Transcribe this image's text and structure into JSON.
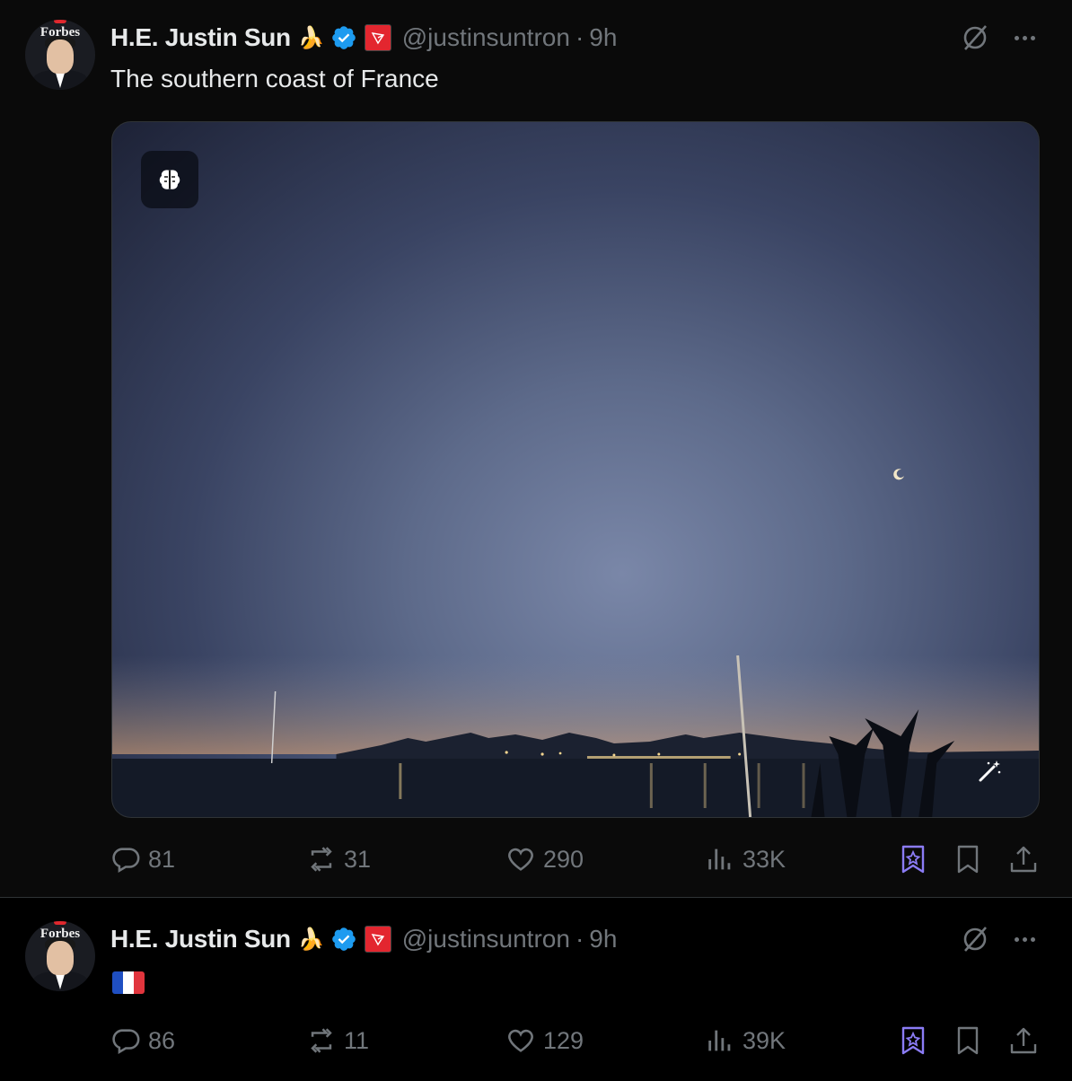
{
  "posts": [
    {
      "author_name": "H.E. Justin Sun",
      "author_emoji": "🍌",
      "handle": "@justinsuntron",
      "separator": "·",
      "time": "9h",
      "text": "The southern coast of France",
      "avatar_label": "Forbes",
      "has_media": true,
      "stats": {
        "replies": "81",
        "reposts": "31",
        "likes": "290",
        "views": "33K"
      }
    },
    {
      "author_name": "H.E. Justin Sun",
      "author_emoji": "🍌",
      "handle": "@justinsuntron",
      "separator": "·",
      "time": "9h",
      "text": "",
      "avatar_label": "Forbes",
      "has_media": false,
      "stats": {
        "replies": "86",
        "reposts": "11",
        "likes": "129",
        "views": "39K"
      }
    }
  ],
  "icons": {
    "verified": "verified-badge-icon",
    "affiliation": "tron-affiliation-icon",
    "grok": "grok-icon",
    "more": "more-icon",
    "reply": "reply-icon",
    "repost": "repost-icon",
    "like": "like-icon",
    "views": "views-icon",
    "grok_bookmark": "grok-bookmark-icon",
    "bookmark": "bookmark-icon",
    "share": "share-icon",
    "media_grok": "grok-brain-icon",
    "media_edit": "magic-wand-icon",
    "flag": "france-flag-icon"
  },
  "colors": {
    "background": "#000000",
    "text": "#e7e9ea",
    "muted": "#71767b",
    "verified": "#1d9bf0",
    "grok_accent": "#8b7cf6",
    "affiliation": "#e3262f"
  }
}
